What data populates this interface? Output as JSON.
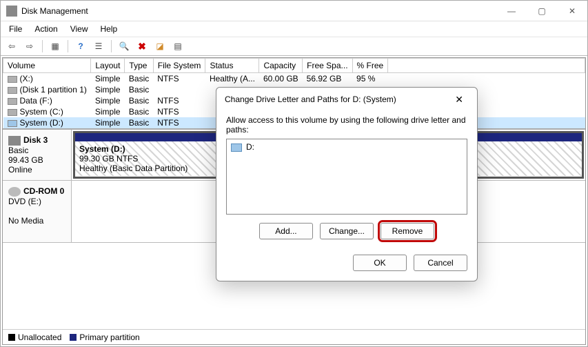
{
  "window": {
    "title": "Disk Management"
  },
  "menu": {
    "file": "File",
    "action": "Action",
    "view": "View",
    "help": "Help"
  },
  "table": {
    "headers": {
      "volume": "Volume",
      "layout": "Layout",
      "type": "Type",
      "fs": "File System",
      "status": "Status",
      "capacity": "Capacity",
      "free": "Free Spa...",
      "pct": "% Free"
    },
    "rows": [
      {
        "name": "(X:)",
        "layout": "Simple",
        "type": "Basic",
        "fs": "NTFS",
        "status": "Healthy (A...",
        "capacity": "60.00 GB",
        "free": "56.92 GB",
        "pct": "95 %"
      },
      {
        "name": "(Disk 1 partition 1)",
        "layout": "Simple",
        "type": "Basic",
        "fs": "",
        "status": "",
        "capacity": "",
        "free": "",
        "pct": ""
      },
      {
        "name": "Data (F:)",
        "layout": "Simple",
        "type": "Basic",
        "fs": "NTFS",
        "status": "",
        "capacity": "",
        "free": "",
        "pct": ""
      },
      {
        "name": "System (C:)",
        "layout": "Simple",
        "type": "Basic",
        "fs": "NTFS",
        "status": "",
        "capacity": "",
        "free": "",
        "pct": ""
      },
      {
        "name": "System (D:)",
        "layout": "Simple",
        "type": "Basic",
        "fs": "NTFS",
        "status": "",
        "capacity": "",
        "free": "",
        "pct": "",
        "selected": true
      }
    ]
  },
  "disks": {
    "disk3": {
      "label": "Disk 3",
      "type": "Basic",
      "size": "99.43 GB",
      "status": "Online",
      "part": {
        "name": "System  (D:)",
        "line2": "99.30 GB NTFS",
        "line3": "Healthy (Basic Data Partition)"
      }
    },
    "cdrom": {
      "label": "CD-ROM 0",
      "sub": "DVD (E:)",
      "status": "No Media"
    }
  },
  "legend": {
    "unalloc": "Unallocated",
    "primary": "Primary partition"
  },
  "dialog": {
    "title": "Change Drive Letter and Paths for D: (System)",
    "instr": "Allow access to this volume by using the following drive letter and paths:",
    "entry": "D:",
    "add": "Add...",
    "change": "Change...",
    "remove": "Remove",
    "ok": "OK",
    "cancel": "Cancel"
  }
}
